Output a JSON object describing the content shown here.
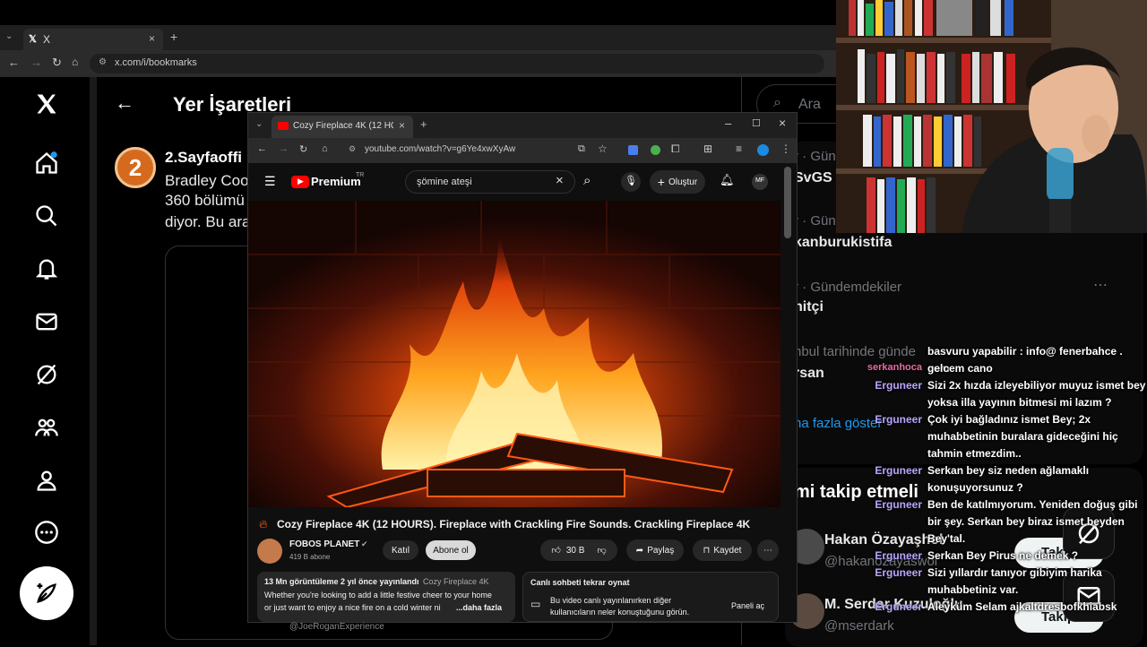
{
  "outer_browser": {
    "tab_title": "X",
    "url": "x.com/i/bookmarks"
  },
  "x_page": {
    "title": "Yer İşaretleri",
    "search_placeholder": "Ara",
    "post": {
      "author": "2.Sayfaoffi",
      "text_line1": "Bradley Coo",
      "text_line2": "360 bölümü",
      "text_line3": "diyor. Bu ara"
    },
    "trends": {
      "meta1": "r · Gün",
      "title1": "SvGS",
      "meta2": "r · Gün",
      "title2": "kanburukistifa",
      "meta3": "r · Gündemdekiler",
      "title3": "nitçi",
      "meta4": "nbul tarihinde günde",
      "title4": "rsan",
      "show_more": "ha fazla göster"
    },
    "who_to_follow": {
      "heading": "mi takip etmeli",
      "users": [
        {
          "name": "Hakan Özayaşhol",
          "handle": "@hakanozayaswol",
          "button": "Takip"
        },
        {
          "name": "M. Serdar Kuzuloğlu",
          "handle": "@mserdark",
          "button": "Takip"
        }
      ]
    }
  },
  "yt_window": {
    "tab_title": "Cozy Fireplace 4K (12 HOUR",
    "url": "youtube.com/watch?v=g6Ye4xwXyAw",
    "logo_text": "Premium",
    "logo_sup": "TR",
    "search_value": "şömine ateşi",
    "create_label": "Oluştur",
    "video_title": "Cozy Fireplace 4K (12 HOURS). Fireplace with Crackling Fire Sounds. Crackling Fireplace 4K",
    "channel": {
      "name": "FOBOS PLANET",
      "subs": "419 B abone",
      "join": "Katıl",
      "subscribe": "Abone ol"
    },
    "actions": {
      "likes": "30 B",
      "share": "Paylaş",
      "save": "Kaydet"
    },
    "description": {
      "stats": "13 Mn görüntüleme  2 yıl önce yayınlandı",
      "tag": "Cozy Fireplace 4K",
      "line1": "Whether you're looking to add a little festive cheer to your home",
      "line2": "or just want to enjoy a nice fire on a cold winter ni",
      "more": "...daha fazla"
    },
    "live_chat": {
      "title": "Canlı sohbeti tekrar oynat",
      "text1": "Bu video canlı yayınlanırken diğer",
      "text2": "kullanıcıların neler konuştuğunu görün.",
      "open": "Paneli aç"
    },
    "below_caption": "@JoeRoganExperience"
  },
  "chat": [
    {
      "user": "",
      "text": "basvuru yapabilir : info@ fenerbahce . com"
    },
    {
      "user": "",
      "text": "gelcem cano"
    },
    {
      "user": "serkanhoca",
      "text": ""
    },
    {
      "user": "Erguneer",
      "text": "Sizi 2x hızda izleyebiliyor muyuz ismet bey"
    },
    {
      "user": "",
      "text": "yoksa illa yayının bitmesi mi lazım ?"
    },
    {
      "user": "Erguneer",
      "text": "Çok iyi bağladınız ismet Bey; 2x"
    },
    {
      "user": "",
      "text": "muhabbetinin buralara gideceğini hiç"
    },
    {
      "user": "",
      "text": "tahmin etmezdim.."
    },
    {
      "user": "Erguneer",
      "text": "Serkan bey siz neden ağlamaklı"
    },
    {
      "user": "",
      "text": "konuşuyorsunuz ?"
    },
    {
      "user": "Erguneer",
      "text": "Ben de katılmıyorum. Yeniden doğuş gibi"
    },
    {
      "user": "",
      "text": "bir şey. Serkan bey biraz ismet beyden"
    },
    {
      "user": "",
      "text": "Bey'tal."
    },
    {
      "user": "Erguneer",
      "text": "Serkan Bey Pirus ne demek ?"
    },
    {
      "user": "Erguneer",
      "text": "Sizi yıllardır tanıyor gibiyim harika"
    },
    {
      "user": "",
      "text": "muhabbetiniz var."
    },
    {
      "user": "Erguneer",
      "text": "Aleyküm Selam ajkaltdresbofkhiabsk"
    }
  ]
}
